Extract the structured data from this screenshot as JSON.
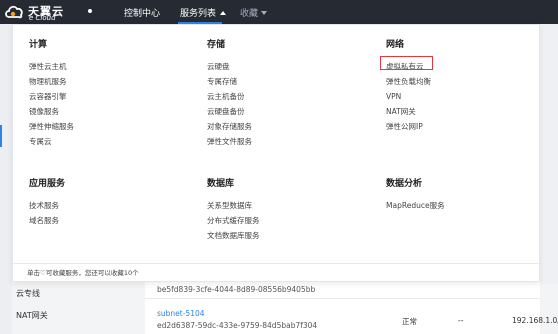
{
  "header": {
    "brand_cn": "天翼云",
    "brand_en": "e Cloud",
    "nav": {
      "console": "控制中心",
      "services": "服务列表",
      "favorites": "收藏"
    }
  },
  "menu": {
    "categories": [
      {
        "title": "计算",
        "items": [
          "弹性云主机",
          "物理机服务",
          "云容器引擎",
          "镜像服务",
          "弹性伸缩服务",
          "专属云"
        ]
      },
      {
        "title": "存储",
        "items": [
          "云硬盘",
          "专属存储",
          "云主机备份",
          "云硬盘备份",
          "对象存储服务",
          "弹性文件服务"
        ]
      },
      {
        "title": "网络",
        "items": [
          "虚拟私有云",
          "弹性负载均衡",
          "VPN",
          "NAT网关",
          "弹性公网IP"
        ]
      },
      {
        "title": "应用服务",
        "items": [
          "技术服务",
          "域名服务"
        ]
      },
      {
        "title": "数据库",
        "items": [
          "关系型数据库",
          "分布式缓存服务",
          "文档数据库服务"
        ]
      },
      {
        "title": "数据分析",
        "items": [
          "MapReduce服务"
        ]
      }
    ],
    "footer": "单击♡可收藏服务，您还可以收藏10个"
  },
  "background": {
    "sidebar": [
      "云专线",
      "NAT网关"
    ],
    "rows": [
      {
        "id_line": "be5fd839-3cfe-4044-8d89-08556b9405bb"
      },
      {
        "name": "subnet-5104",
        "id_line": "ed2d6387-59dc-433e-9759-84d5bab7f304",
        "status": "正常",
        "dash": "--",
        "cidr": "192.168.1.0/"
      }
    ]
  },
  "colors": {
    "topbar": "#262b33",
    "accent": "#2a85e9",
    "highlight": "#e0383e"
  }
}
